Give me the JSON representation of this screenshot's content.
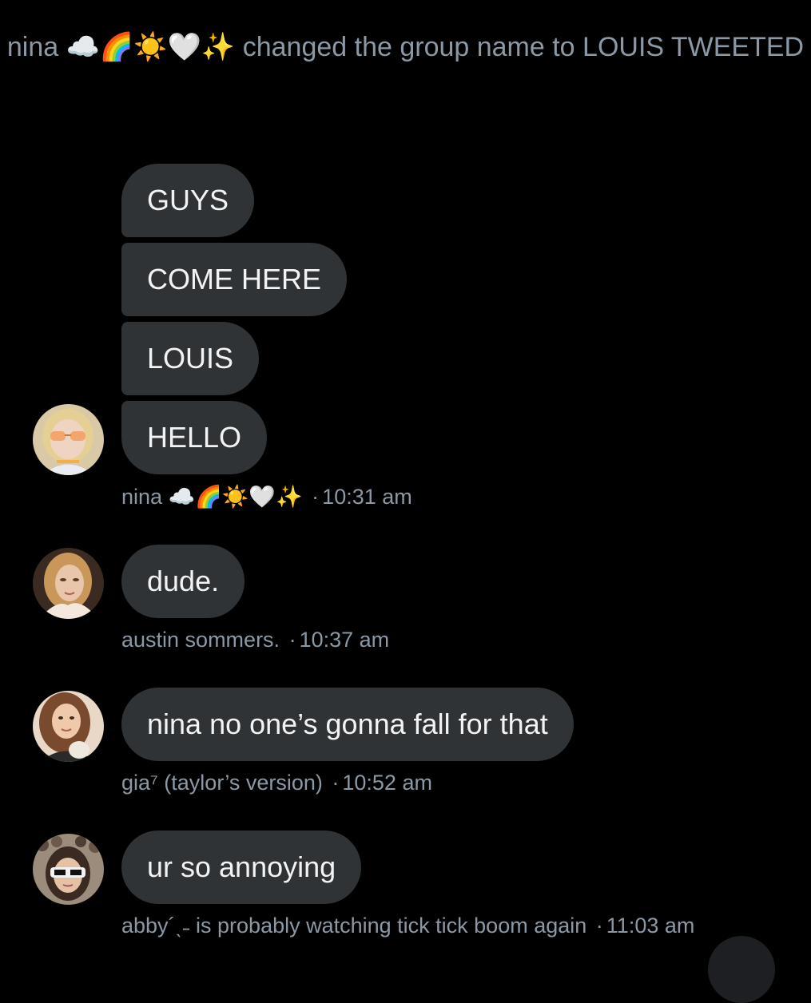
{
  "notice": {
    "actor": "nina",
    "emoji": "☁️🌈☀️🤍✨",
    "action": "changed the group name to LOUIS TWEETED"
  },
  "colors": {
    "background": "#000000",
    "bubble": "#2f3336",
    "bubble_text": "#f3f3f3",
    "meta_text": "#8b98a5"
  },
  "messages": [
    {
      "sender": "nina",
      "sender_emoji": "☁️🌈☀️🤍✨",
      "time": "10:31 am",
      "avatar": "avatar-nina",
      "bubbles": [
        "GUYS",
        "COME HERE",
        "LOUIS",
        "HELLO"
      ]
    },
    {
      "sender": "austin sommers.",
      "time": "10:37 am",
      "avatar": "avatar-austin",
      "bubbles": [
        "dude."
      ]
    },
    {
      "sender": "gia⁷ (taylor’s version)",
      "time": "10:52 am",
      "avatar": "avatar-gia",
      "bubbles": [
        "nina no one’s gonna fall for that"
      ]
    },
    {
      "sender": "abby´ˎ˗ is probably watching tick tick boom again",
      "time": "11:03 am",
      "avatar": "avatar-abby",
      "bubbles": [
        "ur so annoying"
      ]
    }
  ]
}
